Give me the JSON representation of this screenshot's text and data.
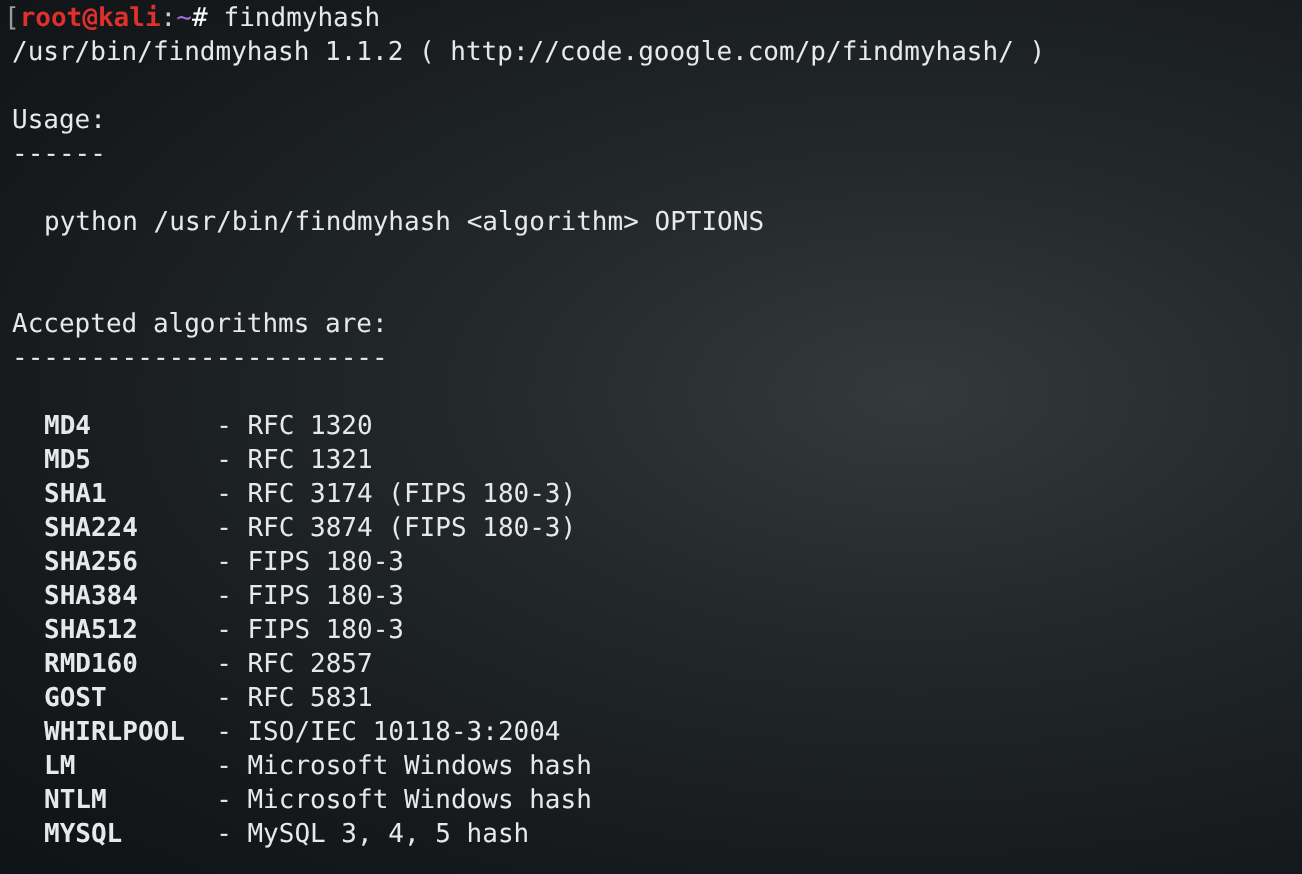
{
  "prompt": {
    "open_bracket": "[",
    "user_host": "root@kali",
    "colon": ":",
    "path": "~",
    "symbol": "#",
    "command": "findmyhash"
  },
  "banner": "/usr/bin/findmyhash 1.1.2 ( http://code.google.com/p/findmyhash/ )",
  "usage": {
    "heading": "Usage:",
    "rule": "------",
    "command": "python /usr/bin/findmyhash <algorithm> OPTIONS"
  },
  "algorithms": {
    "heading": "Accepted algorithms are:",
    "rule": "------------------------",
    "items": [
      {
        "name": "MD4",
        "dash": "-",
        "description": "RFC 1320"
      },
      {
        "name": "MD5",
        "dash": "-",
        "description": "RFC 1321"
      },
      {
        "name": "SHA1",
        "dash": "-",
        "description": "RFC 3174 (FIPS 180-3)"
      },
      {
        "name": "SHA224",
        "dash": "-",
        "description": "RFC 3874 (FIPS 180-3)"
      },
      {
        "name": "SHA256",
        "dash": "-",
        "description": "FIPS 180-3"
      },
      {
        "name": "SHA384",
        "dash": "-",
        "description": "FIPS 180-3"
      },
      {
        "name": "SHA512",
        "dash": "-",
        "description": "FIPS 180-3"
      },
      {
        "name": "RMD160",
        "dash": "-",
        "description": "RFC 2857"
      },
      {
        "name": "GOST",
        "dash": "-",
        "description": "RFC 5831"
      },
      {
        "name": "WHIRLPOOL",
        "dash": "-",
        "description": "ISO/IEC 10118-3:2004"
      },
      {
        "name": "LM",
        "dash": "-",
        "description": "Microsoft Windows hash"
      },
      {
        "name": "NTLM",
        "dash": "-",
        "description": "Microsoft Windows hash"
      },
      {
        "name": "MYSQL",
        "dash": "-",
        "description": "MySQL 3, 4, 5 hash"
      }
    ]
  }
}
